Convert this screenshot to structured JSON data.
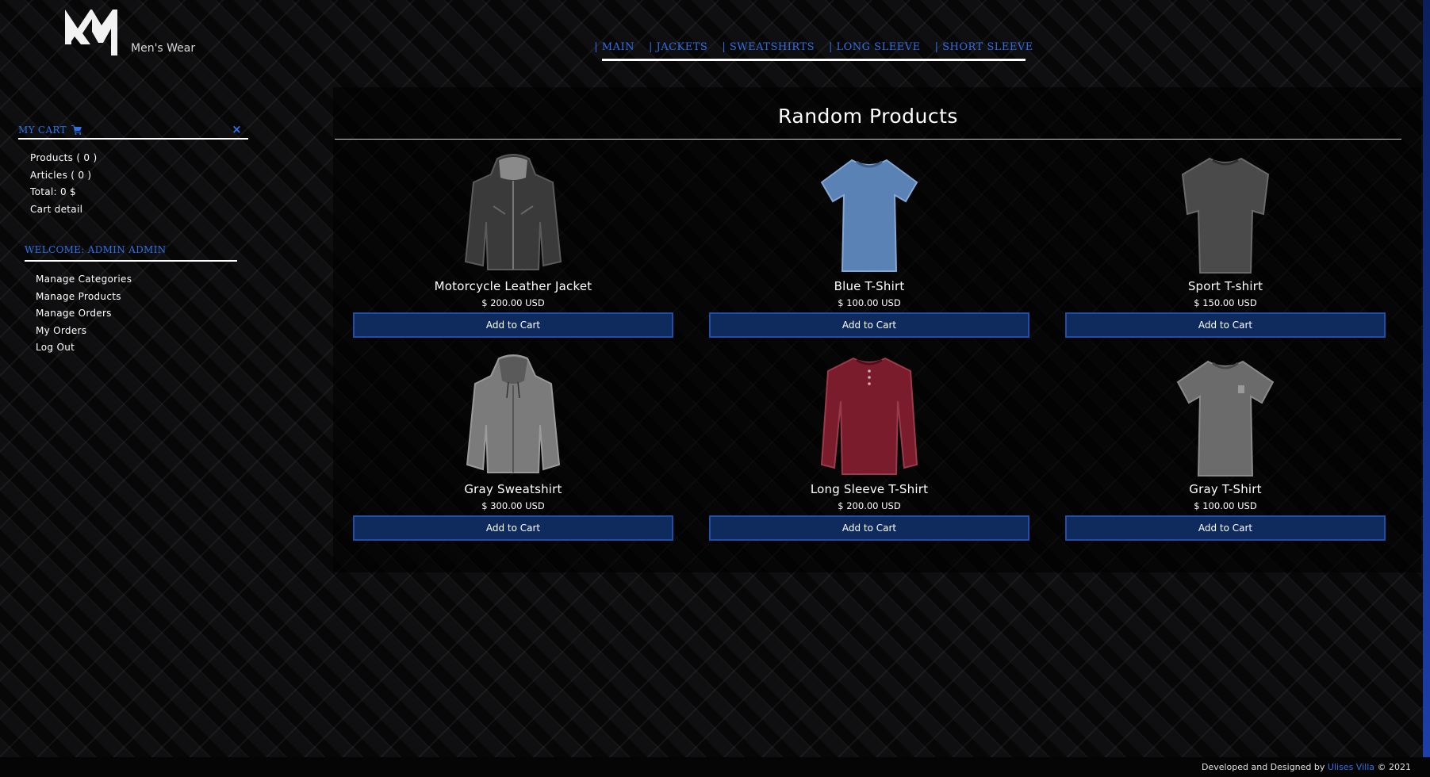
{
  "brand": {
    "name": "Men's Wear",
    "logo_text": "MW"
  },
  "nav": {
    "items": [
      "| MAIN",
      "| JACKETS",
      "| SWEATSHIRTS",
      "| LONG SLEEVE",
      "| SHORT SLEEVE"
    ]
  },
  "cart": {
    "title": "MY CART",
    "close": "×",
    "products": "Products ( 0 )",
    "articles": "Articles ( 0 )",
    "total": "Total: 0 $",
    "detail": "Cart detail"
  },
  "welcome": {
    "title": "WELCOME: ADMIN ADMIN",
    "items": [
      "Manage Categories",
      "Manage Products",
      "Manage Orders",
      "My Orders",
      "Log Out"
    ]
  },
  "main": {
    "title": "Random Products",
    "products": [
      {
        "name": "Motorcycle Leather Jacket",
        "price": "$ 200.00 USD",
        "button": "Add to Cart",
        "color": "#3a3a3a"
      },
      {
        "name": "Blue T-Shirt",
        "price": "$ 100.00 USD",
        "button": "Add to Cart",
        "color": "#5a82b4"
      },
      {
        "name": "Sport T-shirt",
        "price": "$ 150.00 USD",
        "button": "Add to Cart",
        "color": "#4a4a4a"
      },
      {
        "name": "Gray Sweatshirt",
        "price": "$ 300.00 USD",
        "button": "Add to Cart",
        "color": "#7b7b7b"
      },
      {
        "name": "Long Sleeve T-Shirt",
        "price": "$ 200.00 USD",
        "button": "Add to Cart",
        "color": "#7a1c2c"
      },
      {
        "name": "Gray T-Shirt",
        "price": "$ 100.00 USD",
        "button": "Add to Cart",
        "color": "#6b6b6b"
      }
    ]
  },
  "footer": {
    "prefix": "Developed and Designed by",
    "author": "Ulises Villa",
    "suffix": "© 2021"
  }
}
